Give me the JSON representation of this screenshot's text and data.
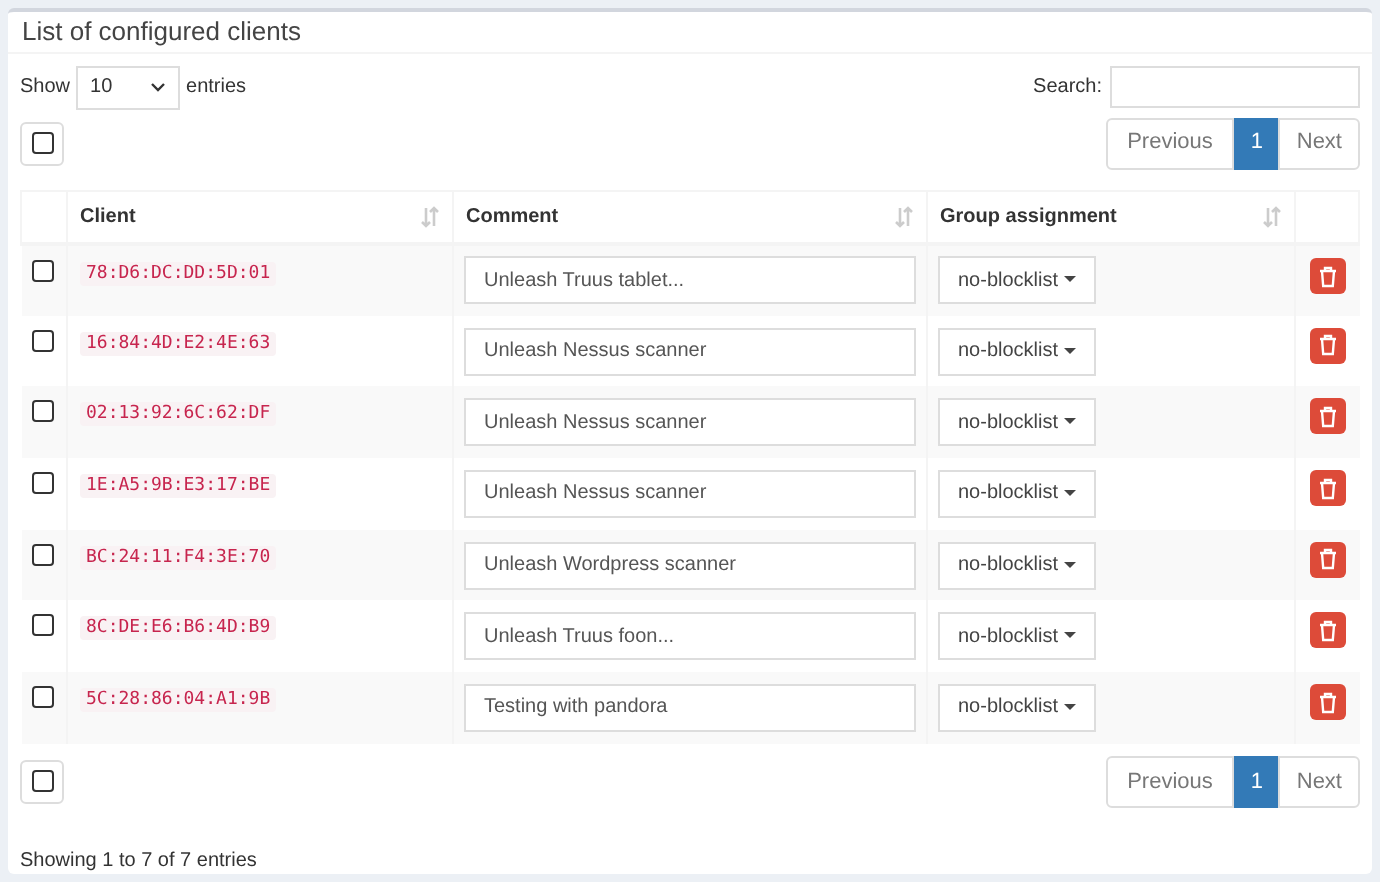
{
  "panel": {
    "title": "List of configured clients"
  },
  "length": {
    "show_label": "Show",
    "value": "10",
    "entries_label": "entries"
  },
  "search": {
    "label": "Search:"
  },
  "select_all_top": {
    "checked": false
  },
  "pagination_top": {
    "previous": "Previous",
    "pages": [
      {
        "label": "1",
        "selected": true
      }
    ],
    "next": "Next"
  },
  "table": {
    "columns": [
      "Client",
      "Comment",
      "Group assignment"
    ],
    "rows": [
      {
        "checked": false,
        "client": "78:D6:DC:DD:5D:01",
        "comment": "Unleash Truus tablet...",
        "group": "no-blocklist"
      },
      {
        "checked": false,
        "client": "16:84:4D:E2:4E:63",
        "comment": "Unleash Nessus scanner",
        "group": "no-blocklist"
      },
      {
        "checked": false,
        "client": "02:13:92:6C:62:DF",
        "comment": "Unleash Nessus scanner",
        "group": "no-blocklist"
      },
      {
        "checked": false,
        "client": "1E:A5:9B:E3:17:BE",
        "comment": "Unleash Nessus scanner",
        "group": "no-blocklist"
      },
      {
        "checked": false,
        "client": "BC:24:11:F4:3E:70",
        "comment": "Unleash Wordpress scanner",
        "group": "no-blocklist"
      },
      {
        "checked": false,
        "client": "8C:DE:E6:B6:4D:B9",
        "comment": "Unleash Truus foon...",
        "group": "no-blocklist"
      },
      {
        "checked": false,
        "client": "5C:28:86:04:A1:9B",
        "comment": "Testing with pandora",
        "group": "no-blocklist"
      }
    ]
  },
  "select_all_bottom": {
    "checked": false
  },
  "pagination_bottom": {
    "previous": "Previous",
    "pages": [
      {
        "label": "1",
        "selected": true
      }
    ],
    "next": "Next"
  },
  "info": "Showing 1 to 7 of 7 entries"
}
